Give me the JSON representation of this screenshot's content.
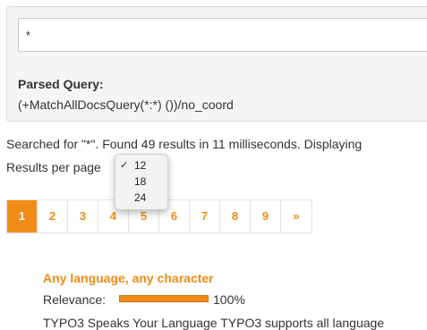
{
  "query": {
    "input_value": "*",
    "parsed_label": "Parsed Query:",
    "parsed_value": "(+MatchAllDocsQuery(*:*) ())/no_coord"
  },
  "summary": "Searched for \"*\". Found 49 results in 11 milliseconds. Displaying",
  "results_per_page": {
    "label": "Results per page",
    "selected": "12",
    "options": [
      {
        "value": "12",
        "check": "✓"
      },
      {
        "value": "18",
        "check": ""
      },
      {
        "value": "24",
        "check": ""
      }
    ]
  },
  "pagination": {
    "active_page": "1",
    "pages": [
      "1",
      "2",
      "3",
      "4",
      "5",
      "6",
      "7",
      "8",
      "9"
    ],
    "next_label": "»"
  },
  "result": {
    "title": "Any language, any character",
    "relevance_label": "Relevance:",
    "relevance_percent": 100,
    "relevance_value": "100%",
    "description": "TYPO3 Speaks Your Language TYPO3 supports all language"
  },
  "colors": {
    "accent": "#f18b17"
  }
}
